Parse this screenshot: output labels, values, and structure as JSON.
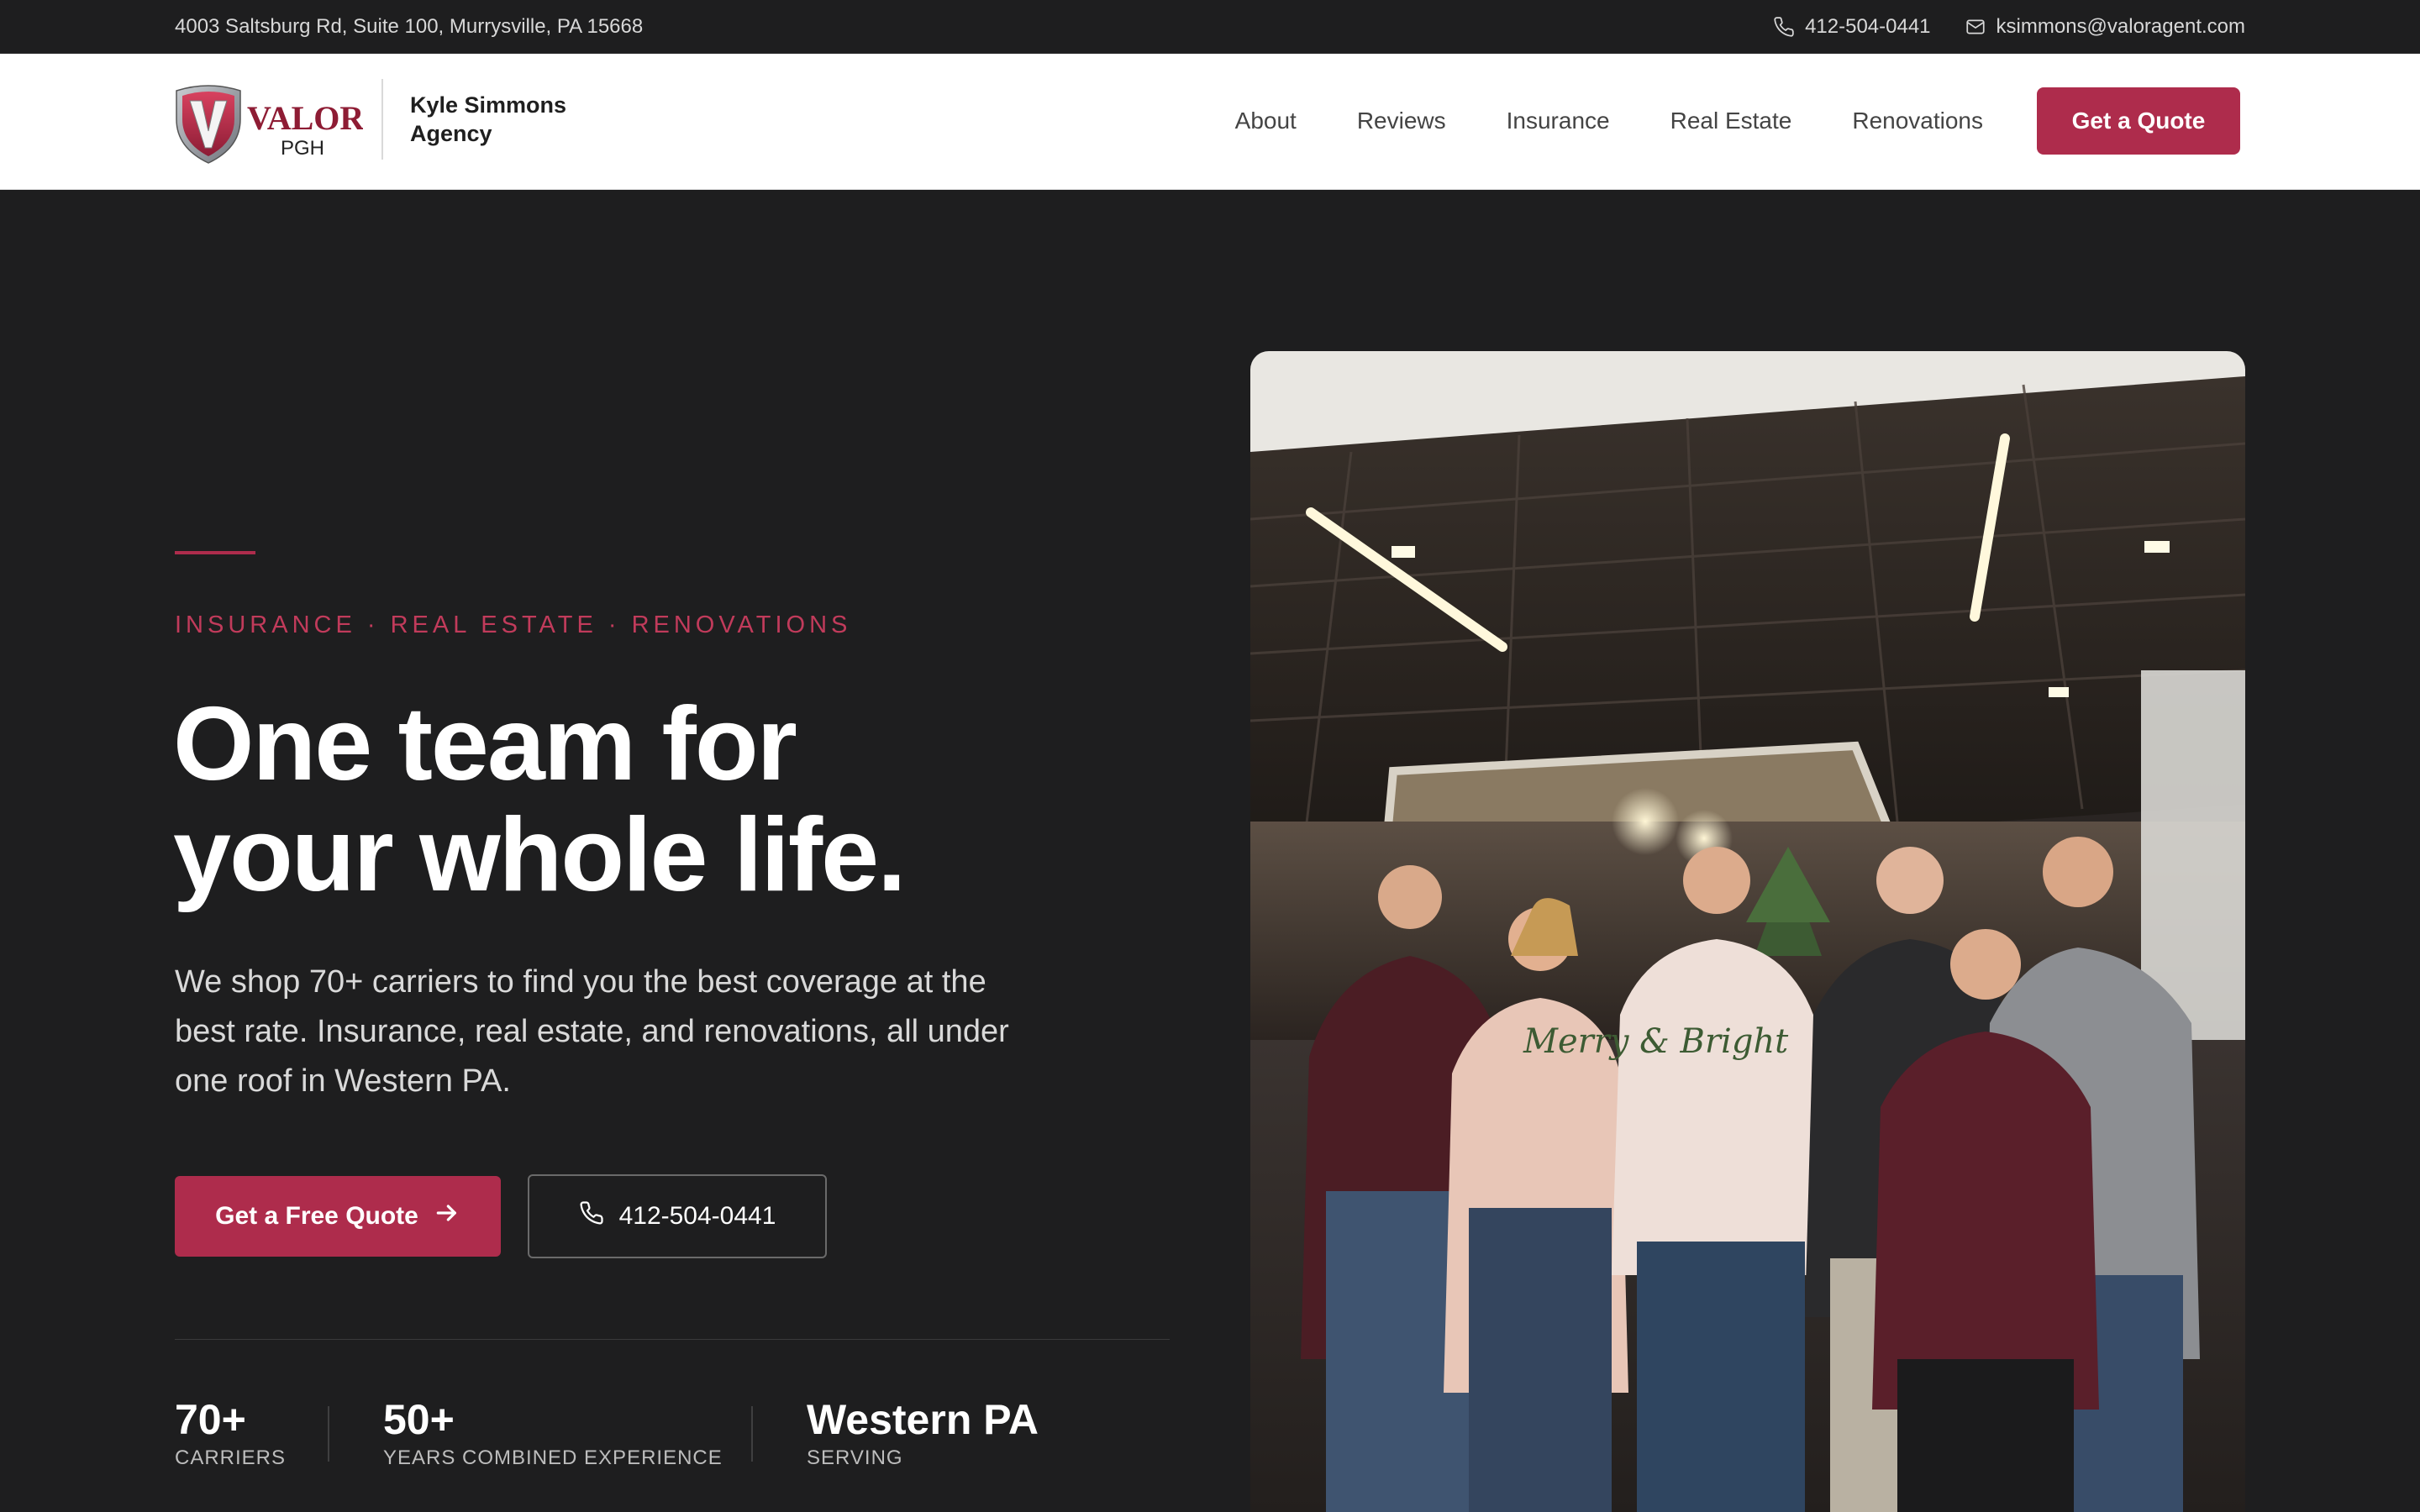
{
  "topbar": {
    "address": "4003 Saltsburg Rd, Suite 100, Murrysville, PA 15668",
    "phone": "412-504-0441",
    "email": "ksimmons@valoragent.com"
  },
  "header": {
    "logo": {
      "wordmark": "VALOR",
      "sub": "PGH"
    },
    "agency_line1": "Kyle Simmons",
    "agency_line2": "Agency",
    "nav": [
      "About",
      "Reviews",
      "Insurance",
      "Real Estate",
      "Renovations"
    ],
    "cta": "Get a Quote"
  },
  "hero": {
    "eyebrow": "INSURANCE · REAL ESTATE · RENOVATIONS",
    "headline_line1": "One team for",
    "headline_line2": "your whole life.",
    "subtext": "We shop 70+ carriers to find you the best coverage at the best rate. Insurance, real estate, and renovations, all under one roof in Western PA.",
    "primary_cta": "Get a Free Quote",
    "secondary_cta": "412-504-0441",
    "stats": [
      {
        "value": "70+",
        "label": "CARRIERS"
      },
      {
        "value": "50+",
        "label": "YEARS COMBINED EXPERIENCE"
      },
      {
        "value": "Western PA",
        "label": "SERVING"
      }
    ],
    "photo_sweater_text": "Merry & Bright"
  },
  "colors": {
    "accent": "#ae2c4c",
    "eyebrow": "#c13b5b",
    "dark_bg": "#1e1e1f",
    "header_bg": "#ffffff"
  },
  "icons": {
    "phone": "phone-icon",
    "email": "mail-icon",
    "arrow": "arrow-right-icon"
  }
}
